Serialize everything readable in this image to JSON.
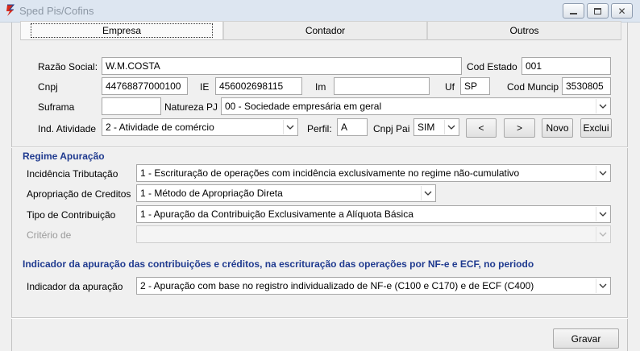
{
  "window": {
    "title": "Sped Pis/Cofins"
  },
  "tabs": [
    {
      "label": "Empresa"
    },
    {
      "label": "Contador"
    },
    {
      "label": "Outros"
    }
  ],
  "empresa": {
    "razao_social_label": "Razão Social:",
    "razao_social_value": "W.M.COSTA",
    "cod_estado_label": "Cod Estado",
    "cod_estado_value": "001",
    "cnpj_label": "Cnpj",
    "cnpj_value": "44768877000100",
    "ie_label": "IE",
    "ie_value": "456002698115",
    "im_label": "Im",
    "im_value": "",
    "uf_label": "Uf",
    "uf_value": "SP",
    "cod_muncip_label": "Cod Muncip",
    "cod_muncip_value": "3530805",
    "suframa_label": "Suframa",
    "suframa_value": "",
    "natureza_pj_label": "Natureza PJ",
    "natureza_pj_value": "00 - Sociedade empresária em geral",
    "ind_atividade_label": "Ind. Atividade",
    "ind_atividade_value": "2 - Atividade de comércio",
    "perfil_label": "Perfil:",
    "perfil_value": "A",
    "cnpj_pai_label": "Cnpj Pai",
    "cnpj_pai_value": "SIM",
    "prev_button": "<",
    "next_button": ">",
    "novo_button": "Novo",
    "exclui_button": "Exclui"
  },
  "regime": {
    "section_title": "Regime Apuração",
    "incidencia_label": "Incidência  Tributação",
    "incidencia_value": "1 - Escrituração de operações com incidência exclusivamente no regime não-cumulativo",
    "apropriacao_label": "Apropriação de Creditos",
    "apropriacao_value": "1 - Método de Apropriação Direta",
    "tipo_contribuicao_label": "Tipo de Contribuição",
    "tipo_contribuicao_value": "1 - Apuração da Contribuição Exclusivamente a Alíquota Básica",
    "criterio_label": "Critério de",
    "criterio_value": ""
  },
  "indicador": {
    "section_title": "Indicador da apuração das contribuições e créditos, na escrituração das operações por NF-e e ECF, no periodo",
    "indicador_label": "Indicador da apuração",
    "indicador_value": "2 - Apuração com base no registro individualizado de NF-e (C100 e C170) e de ECF (C400)"
  },
  "footer": {
    "gravar_button": "Gravar"
  },
  "colors": {
    "section_title": "#1f3a8f",
    "titlebar": "#dde6f1"
  }
}
